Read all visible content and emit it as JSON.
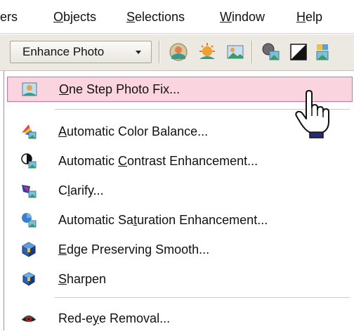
{
  "menubar": {
    "items": [
      {
        "pre": "",
        "u": "",
        "post": "ers"
      },
      {
        "pre": "",
        "u": "O",
        "post": "bjects"
      },
      {
        "pre": "",
        "u": "S",
        "post": "elections"
      },
      {
        "pre": "",
        "u": "W",
        "post": "indow"
      },
      {
        "pre": "",
        "u": "H",
        "post": "elp"
      }
    ]
  },
  "toolbar": {
    "dropdown_label": "Enhance Photo",
    "icons": [
      "one-step-photo-fix-icon",
      "photo-sun-icon",
      "photo-landscape-icon",
      "color-balance-icon",
      "contrast-icon",
      "saturation-icon"
    ]
  },
  "menu": {
    "items": [
      {
        "icon": "one-step-photo-fix-icon",
        "pre": "",
        "u": "O",
        "post": "ne Step Photo Fix...",
        "highlighted": true
      },
      {
        "icon": "automatic-color-balance-icon",
        "pre": "",
        "u": "A",
        "post": "utomatic Color Balance..."
      },
      {
        "icon": "automatic-contrast-icon",
        "pre": "Automatic ",
        "u": "C",
        "post": "ontrast Enhancement..."
      },
      {
        "icon": "clarify-icon",
        "pre": "C",
        "u": "l",
        "post": "arify..."
      },
      {
        "icon": "automatic-saturation-icon",
        "pre": "Automatic Sa",
        "u": "t",
        "post": "uration Enhancement..."
      },
      {
        "icon": "edge-preserving-smooth-icon",
        "pre": "",
        "u": "E",
        "post": "dge Preserving Smooth..."
      },
      {
        "icon": "sharpen-icon",
        "pre": "",
        "u": "S",
        "post": "harpen"
      },
      {
        "icon": "red-eye-removal-icon",
        "pre": "Red-e",
        "u": "y",
        "post": "e Removal..."
      }
    ]
  },
  "colors": {
    "highlight_bg": "#fad4df",
    "highlight_border": "#e06b93",
    "toolbar_bg": "#ece9e2"
  }
}
